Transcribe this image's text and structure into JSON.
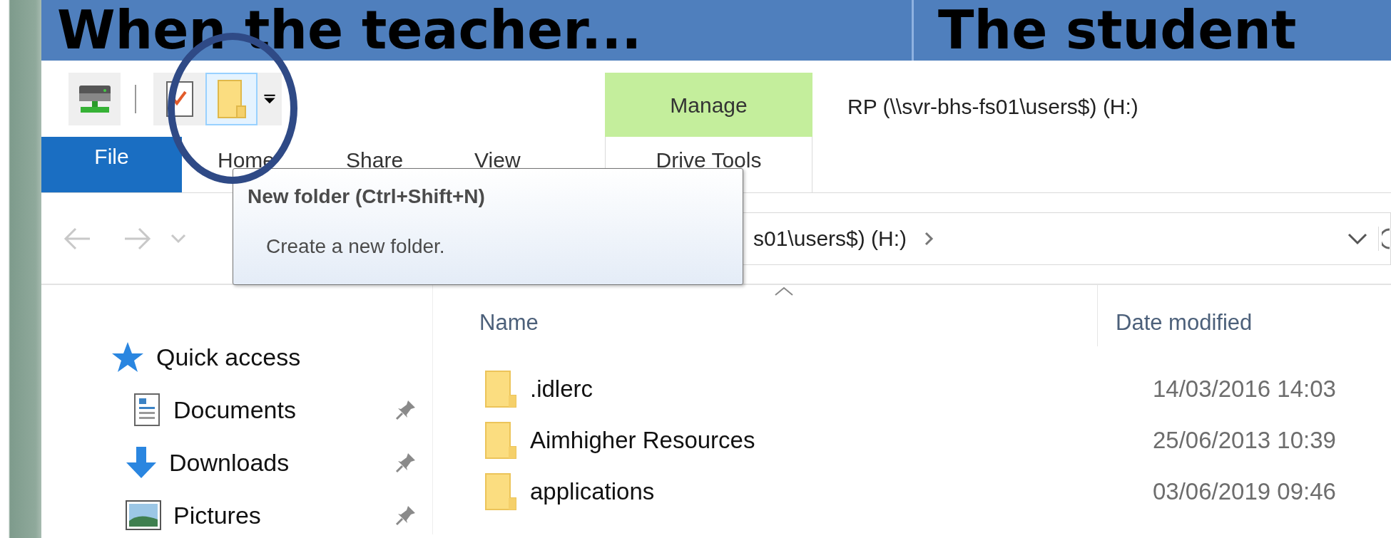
{
  "slide": {
    "headings": [
      "When the teacher...",
      "The student"
    ]
  },
  "window": {
    "title": "RP (\\\\svr-bhs-fs01\\users$) (H:)",
    "quick_access_toolbar": [
      {
        "kind": "drive",
        "hovered": false
      },
      {
        "kind": "properties",
        "hovered": false
      },
      {
        "kind": "new_folder",
        "hovered": true
      },
      {
        "kind": "customize",
        "hovered": false
      }
    ],
    "ribbon_tabs": [
      {
        "label": "File",
        "kind": "file",
        "selected": false
      },
      {
        "label": "Home",
        "kind": "tab",
        "selected": false
      },
      {
        "label": "Share",
        "kind": "tab",
        "selected": false
      },
      {
        "label": "View",
        "kind": "tab",
        "selected": false
      }
    ],
    "context_tab": {
      "group": "Manage",
      "label": "Drive Tools",
      "selected": false
    },
    "tooltip": {
      "title": "New folder (Ctrl+Shift+N)",
      "text": "Create a new folder."
    },
    "address_bar": {
      "path": "s01\\users$) (H:)"
    },
    "navigation_pane": {
      "items": [
        {
          "label": "Quick access",
          "kind": "quick_access",
          "pinned": false
        },
        {
          "label": "Documents",
          "kind": "documents",
          "pinned": true
        },
        {
          "label": "Downloads",
          "kind": "downloads",
          "pinned": true
        },
        {
          "label": "Pictures",
          "kind": "pictures",
          "pinned": true
        }
      ]
    },
    "file_list": {
      "columns": [
        "Name",
        "Date modified"
      ],
      "rows": [
        {
          "name": ".idlerc",
          "date_modified": "14/03/2016 14:03"
        },
        {
          "name": "Aimhigher Resources",
          "date_modified": "25/06/2013 10:39"
        },
        {
          "name": "applications",
          "date_modified": "03/06/2019 09:46"
        }
      ]
    }
  }
}
